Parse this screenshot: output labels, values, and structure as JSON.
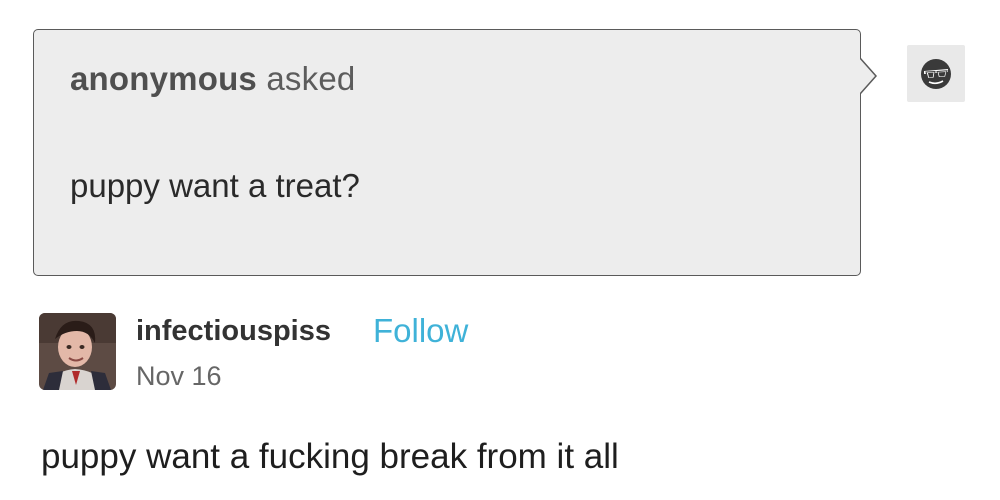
{
  "ask": {
    "asker": "anonymous",
    "asked_label": "asked",
    "question": "puppy want a treat?",
    "avatar_icon": "anonymous-sunglasses-icon"
  },
  "answer": {
    "username": "infectiouspiss",
    "follow_label": "Follow",
    "date": "Nov 16",
    "text": "puppy want a fucking break from it all"
  },
  "colors": {
    "ask_background": "#ededed",
    "ask_border": "#5a5a5a",
    "follow_link": "#3fb2d8",
    "username": "#333333",
    "date": "#666666"
  }
}
